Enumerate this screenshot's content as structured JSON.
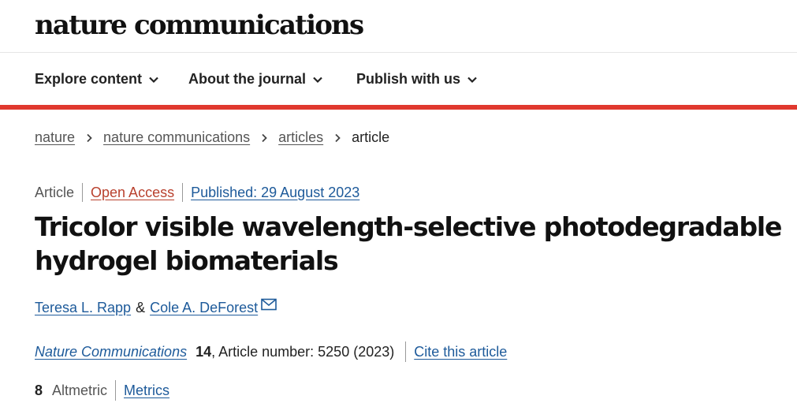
{
  "site": {
    "logo_text": "nature communications"
  },
  "nav": {
    "items": [
      {
        "label": "Explore content"
      },
      {
        "label": "About the journal"
      },
      {
        "label": "Publish with us"
      }
    ]
  },
  "breadcrumb": {
    "items": [
      "nature",
      "nature communications",
      "articles"
    ],
    "current": "article"
  },
  "article": {
    "type": "Article",
    "access": "Open Access",
    "published": "Published: 29 August 2023",
    "title": "Tricolor visible wavelength-selective photodegradable hydrogel biomaterials",
    "authors": [
      "Teresa L. Rapp",
      "Cole A. DeForest"
    ],
    "author_separator": "&",
    "journal": "Nature Communications",
    "volume": "14",
    "article_number": ", Article number: 5250 (2023)",
    "cite_label": "Cite this article"
  },
  "metrics": {
    "altmetric_count": "8",
    "altmetric_label": "Altmetric",
    "metrics_link": "Metrics"
  },
  "colors": {
    "accent_red": "#e0382e",
    "link_blue": "#1d5a9a",
    "open_access": "#b9412e"
  },
  "icons": [
    "chevron-down-icon",
    "chevron-right-icon",
    "mail-icon"
  ]
}
